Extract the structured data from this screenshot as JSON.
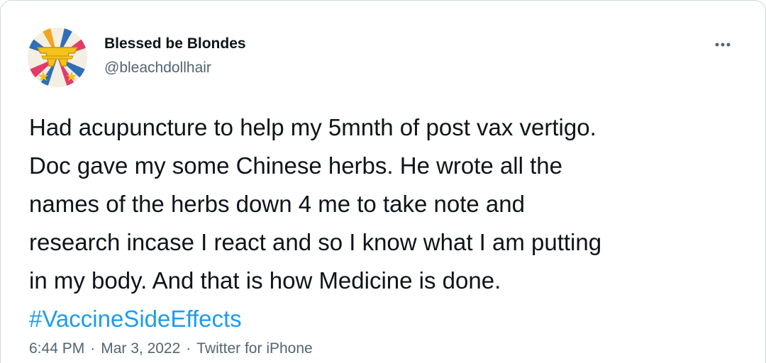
{
  "tweet": {
    "author": {
      "display_name": "Blessed be Blondes",
      "handle": "@bleachdollhair",
      "avatar_icon": "wonder-woman-logo-avatar-icon"
    },
    "more_icon": "more-horizontal-icon",
    "text_lines": [
      "Had acupuncture to help my 5mnth of post vax vertigo.",
      "Doc gave my some Chinese herbs. He wrote all the",
      "names of the herbs down 4 me to take note and",
      "research incase I react and so I know what I am putting",
      "in my body. And that is how Medicine is done."
    ],
    "hashtag": "#VaccineSideEffects",
    "time": "6:44 PM",
    "separator": "·",
    "date": "Mar 3, 2022",
    "source": "Twitter for iPhone"
  },
  "colors": {
    "text": "#0f1419",
    "secondary": "#536471",
    "link": "#1d9bf0",
    "border": "#cfd9de"
  }
}
